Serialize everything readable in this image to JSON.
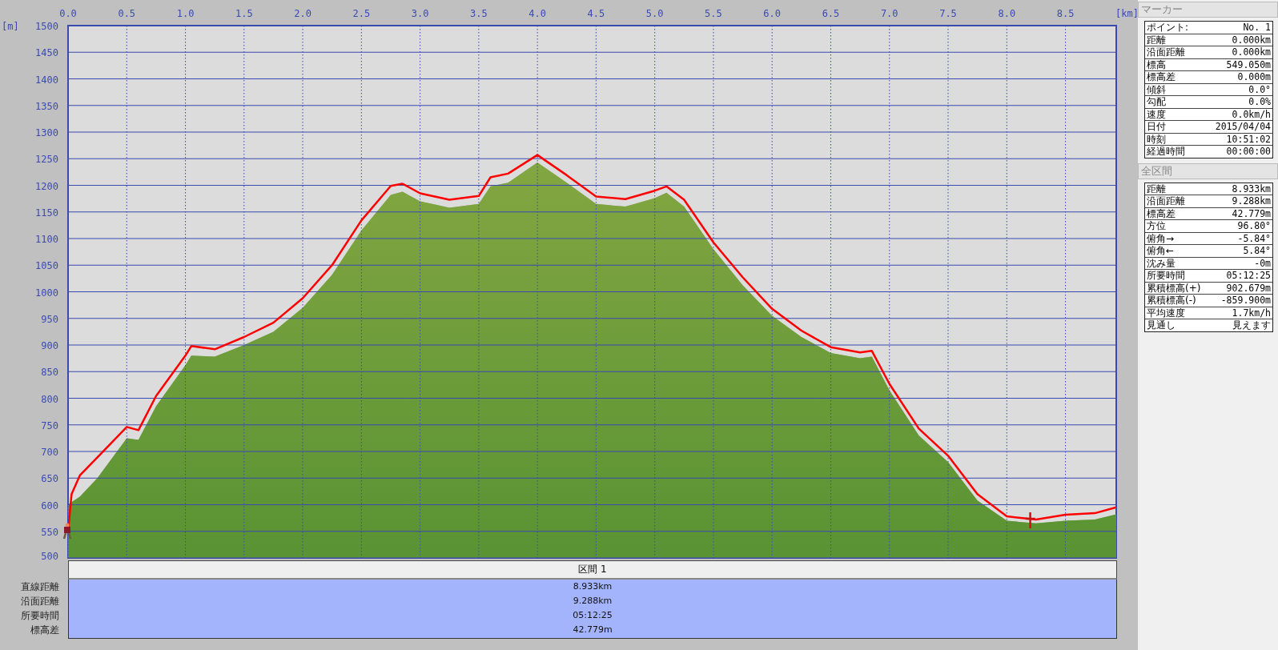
{
  "chart": {
    "y_unit": "[m]",
    "x_unit": "[km]",
    "chart_data": {
      "type": "area",
      "x": [
        0,
        0.03,
        0.1,
        0.25,
        0.5,
        0.6,
        0.75,
        1.0,
        1.05,
        1.25,
        1.5,
        1.75,
        2.0,
        2.25,
        2.5,
        2.75,
        2.85,
        3.0,
        3.25,
        3.5,
        3.6,
        3.75,
        4.0,
        4.25,
        4.5,
        4.75,
        5.0,
        5.1,
        5.25,
        5.5,
        5.75,
        6.0,
        6.25,
        6.5,
        6.75,
        6.85,
        7.0,
        7.25,
        7.5,
        7.75,
        8.0,
        8.25,
        8.5,
        8.75,
        8.933
      ],
      "series": [
        {
          "color": "#6a9a38",
          "values": [
            600,
            605,
            615,
            650,
            725,
            722,
            785,
            862,
            880,
            878,
            900,
            925,
            970,
            1032,
            1115,
            1182,
            1188,
            1170,
            1158,
            1165,
            1198,
            1205,
            1243,
            1205,
            1165,
            1160,
            1176,
            1186,
            1160,
            1080,
            1012,
            955,
            915,
            885,
            875,
            878,
            815,
            730,
            680,
            608,
            570,
            565,
            570,
            572,
            582
          ]
        },
        {
          "type": "line",
          "color": "#ff0000",
          "values": [
            549,
            620,
            655,
            689,
            746,
            740,
            804,
            880,
            898,
            892,
            915,
            942,
            988,
            1050,
            1134,
            1199,
            1203,
            1185,
            1173,
            1180,
            1215,
            1222,
            1257,
            1219,
            1179,
            1174,
            1190,
            1198,
            1173,
            1093,
            1027,
            968,
            927,
            896,
            886,
            889,
            827,
            743,
            692,
            620,
            578,
            572,
            581,
            584,
            595
          ]
        }
      ],
      "grid": true,
      "xlim": [
        0,
        8.933
      ],
      "ylim": [
        500,
        1500
      ],
      "xticks": [
        {
          "value": 0,
          "label": "0.0"
        },
        {
          "value": 0.5,
          "label": "0.5"
        },
        {
          "value": 1,
          "label": "1.0"
        },
        {
          "value": 1.5,
          "label": "1.5"
        },
        {
          "value": 2,
          "label": "2.0"
        },
        {
          "value": 2.5,
          "label": "2.5"
        },
        {
          "value": 3,
          "label": "3.0"
        },
        {
          "value": 3.5,
          "label": "3.5"
        },
        {
          "value": 4,
          "label": "4.0"
        },
        {
          "value": 4.5,
          "label": "4.5"
        },
        {
          "value": 5,
          "label": "5.0"
        },
        {
          "value": 5.5,
          "label": "5.5"
        },
        {
          "value": 6,
          "label": "6.0"
        },
        {
          "value": 6.5,
          "label": "6.5"
        },
        {
          "value": 7,
          "label": "7.0"
        },
        {
          "value": 7.5,
          "label": "7.5"
        },
        {
          "value": 8,
          "label": "8.0"
        },
        {
          "value": 8.5,
          "label": "8.5"
        }
      ],
      "yticks": [
        500,
        550,
        600,
        650,
        700,
        750,
        800,
        850,
        900,
        950,
        1000,
        1050,
        1100,
        1150,
        1200,
        1250,
        1300,
        1350,
        1400,
        1450,
        1500
      ]
    }
  },
  "section_table": {
    "header": "区間 1",
    "rows": [
      {
        "label": "直線距離",
        "value": "8.933km"
      },
      {
        "label": "沿面距離",
        "value": "9.288km"
      },
      {
        "label": "所要時間",
        "value": "05:12:25"
      },
      {
        "label": "標高差",
        "value": "42.779m"
      }
    ]
  },
  "marker_panel": {
    "title": "マーカー",
    "rows": [
      {
        "label": "ポイント:",
        "value": "No. 1"
      },
      {
        "label": "距離",
        "value": "0.000km"
      },
      {
        "label": "沿面距離",
        "value": "0.000km"
      },
      {
        "label": "標高",
        "value": "549.050m"
      },
      {
        "label": "標高差",
        "value": "0.000m"
      },
      {
        "label": "傾斜",
        "value": "0.0°"
      },
      {
        "label": "勾配",
        "value": "0.0%"
      },
      {
        "label": "速度",
        "value": "0.0km/h"
      },
      {
        "label": "日付",
        "value": "2015/04/04"
      },
      {
        "label": "時刻",
        "value": "10:51:02"
      },
      {
        "label": "経過時間",
        "value": "00:00:00"
      }
    ]
  },
  "total_panel": {
    "title": "全区間",
    "rows": [
      {
        "label": "距離",
        "value": "8.933km"
      },
      {
        "label": "沿面距離",
        "value": "9.288km"
      },
      {
        "label": "標高差",
        "value": "42.779m"
      },
      {
        "label": "方位",
        "value": "96.80°"
      },
      {
        "label": "俯角→",
        "value": "-5.84°"
      },
      {
        "label": "俯角←",
        "value": "5.84°"
      },
      {
        "label": "沈み量",
        "value": "-0m"
      },
      {
        "label": "所要時間",
        "value": "05:12:25"
      },
      {
        "label": "累積標高(+)",
        "value": "902.679m"
      },
      {
        "label": "累積標高(-)",
        "value": "-859.900m"
      },
      {
        "label": "平均速度",
        "value": "1.7km/h"
      },
      {
        "label": "見通し",
        "value": "見えます"
      }
    ]
  }
}
